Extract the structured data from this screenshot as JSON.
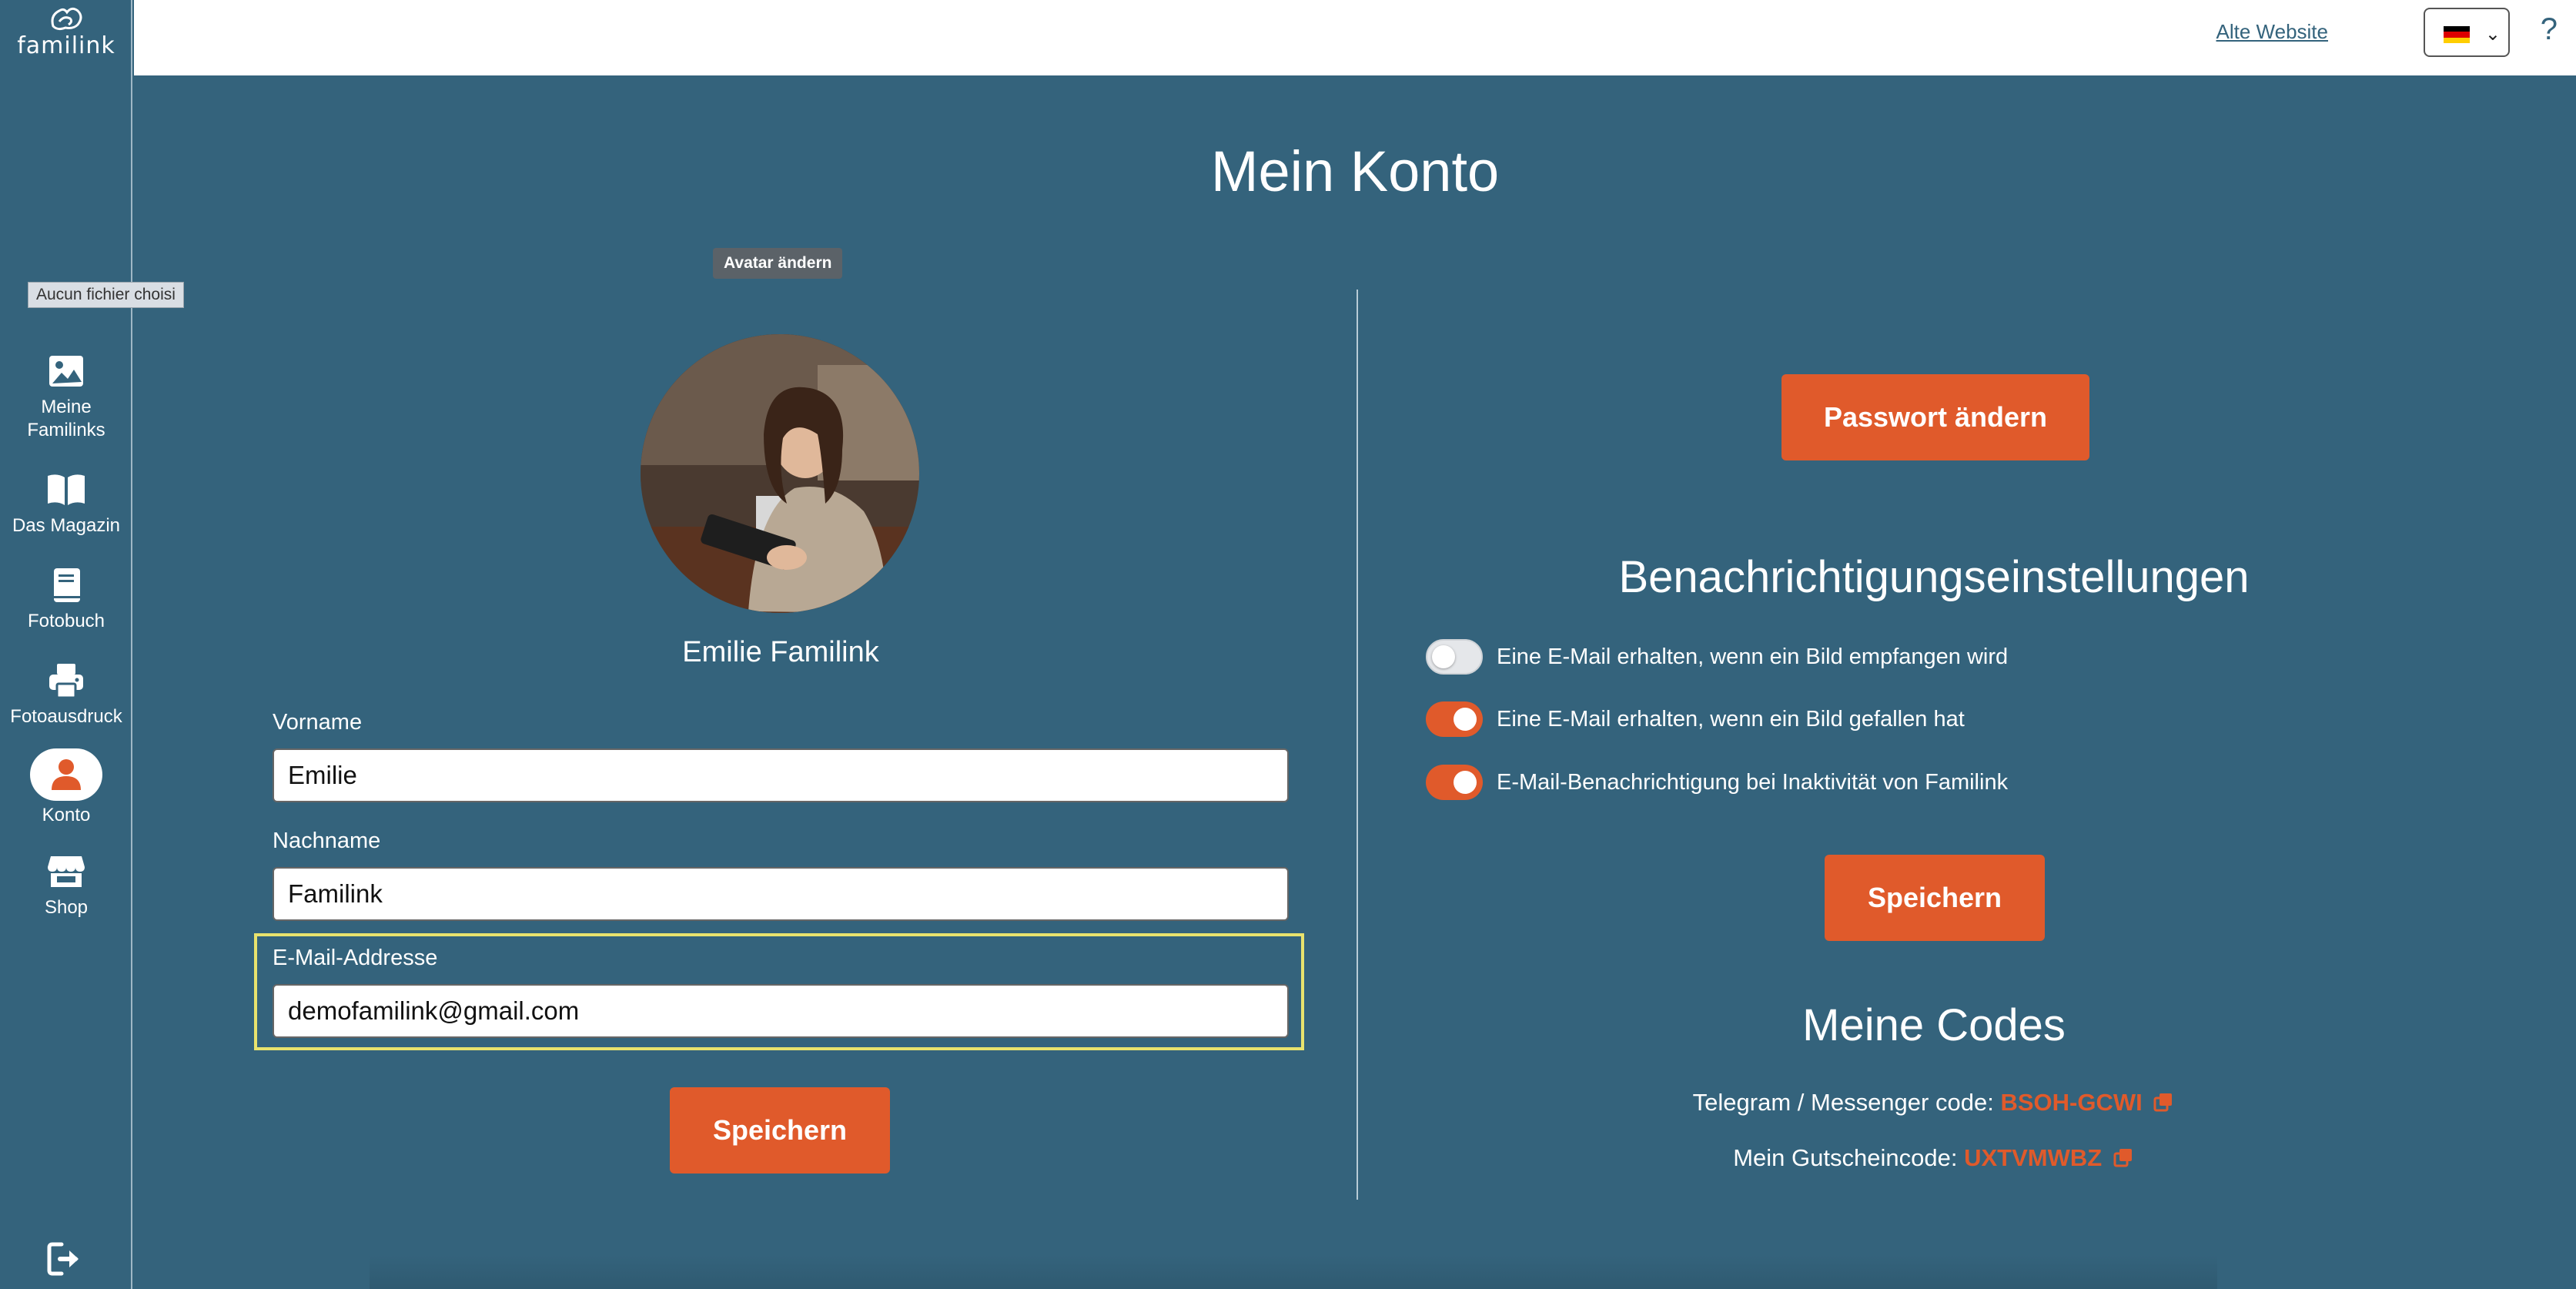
{
  "sidebar": {
    "logo_text": "familink",
    "file_input_tooltip": "Aucun fichier choisi",
    "items": [
      {
        "label_line1": "Meine",
        "label_line2": "Familinks",
        "icon": "image-icon"
      },
      {
        "label": "Das Magazin",
        "icon": "book-open-icon"
      },
      {
        "label": "Fotobuch",
        "icon": "book-icon"
      },
      {
        "label": "Fotoausdruck",
        "icon": "printer-icon"
      },
      {
        "label": "Konto",
        "icon": "user-icon",
        "active": true
      },
      {
        "label": "Shop",
        "icon": "store-icon"
      }
    ],
    "logout_icon": "logout-icon"
  },
  "topbar": {
    "old_site_link": "Alte Website",
    "language": "de",
    "help": "?"
  },
  "page": {
    "title": "Mein Konto"
  },
  "profile": {
    "avatar_button": "Avatar ändern",
    "full_name": "Emilie Familink",
    "first_name_label": "Vorname",
    "first_name_value": "Emilie",
    "last_name_label": "Nachname",
    "last_name_value": "Familink",
    "email_label": "E-Mail-Addresse",
    "email_value": "demofamilink@gmail.com",
    "save_button": "Speichern"
  },
  "settings": {
    "change_password_button": "Passwort ändern",
    "notifications_title": "Benachrichtigungseinstellungen",
    "toggles": [
      {
        "label": "Eine E-Mail erhalten, wenn ein Bild empfangen wird",
        "on": false
      },
      {
        "label": "Eine E-Mail erhalten, wenn ein Bild gefallen hat",
        "on": true
      },
      {
        "label": "E-Mail-Benachrichtigung bei Inaktivität von Familink",
        "on": true
      }
    ],
    "save_button": "Speichern"
  },
  "codes": {
    "title": "Meine Codes",
    "telegram_label": "Telegram / Messenger code:",
    "telegram_code": "BSOH-GCWI",
    "voucher_label": "Mein Gutscheincode:",
    "voucher_code": "UXTVMWBZ"
  },
  "colors": {
    "background": "#34637c",
    "accent": "#e05a2b",
    "focus_outline": "#e9e36d"
  }
}
